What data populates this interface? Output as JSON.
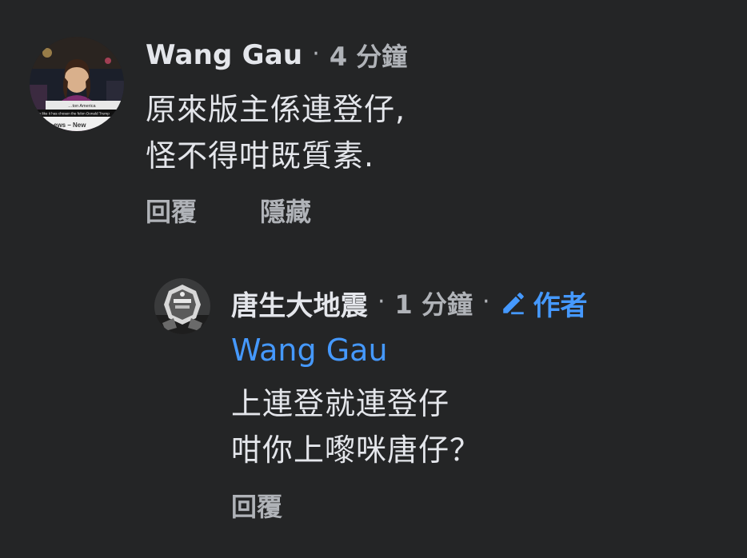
{
  "comment": {
    "author": "Wang Gau",
    "separator": "·",
    "time": "4 分鐘",
    "lines": [
      "原來版主係連登仔,",
      "怪不得咁既質素."
    ],
    "actions": {
      "reply": "回覆",
      "hide": "隱藏"
    },
    "avatar": {
      "caption_1": "…ton America",
      "caption_2": "Looks like it has chosen the felon Donald Trump",
      "caption_3": "ews – New"
    }
  },
  "reply": {
    "author": "唐生大地震",
    "separator": "·",
    "time": "1 分鐘",
    "badge": "作者",
    "badge_icon": "pencil-icon",
    "mention": "Wang Gau",
    "lines": [
      "上連登就連登仔",
      "咁你上嚟咪唐仔？"
    ],
    "actions": {
      "reply": "回覆"
    }
  },
  "colors": {
    "background": "#242526",
    "primary_text": "#e4e6eb",
    "secondary_text": "#b0b3b8",
    "link": "#4599ff"
  }
}
